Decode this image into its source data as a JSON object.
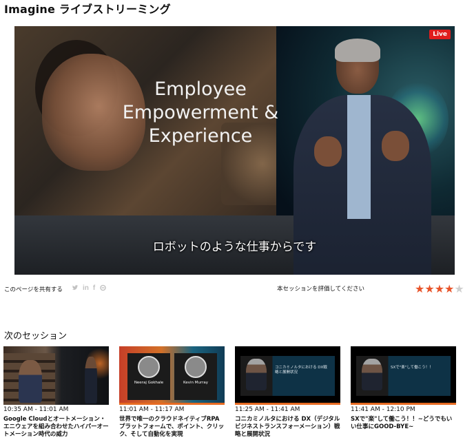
{
  "page": {
    "title": "Imagine ライブストリーミング"
  },
  "player": {
    "live_label": "Live",
    "slide_title_lines": [
      "Employee",
      "Empowerment &",
      "Experience"
    ],
    "subtitle": "ロボットのような仕事からです"
  },
  "share": {
    "label": "このページを共有する",
    "icons": [
      "twitter-icon",
      "linkedin-icon",
      "facebook-icon",
      "link-icon"
    ]
  },
  "rating": {
    "label": "本セッションを評価してください",
    "value": 4,
    "max": 5,
    "accent_color": "#e8542a"
  },
  "next_sessions": {
    "heading": "次のセッション",
    "items": [
      {
        "time": "10:35 AM - 11:01 AM",
        "title": "Google Cloudとオートメーション・エニウェアを組み合わせたハイパーオートメーション時代の威力"
      },
      {
        "time": "11:01 AM - 11:17 AM",
        "title": "世界で唯一のクラウドネイティブRPAプラットフォームで、ポイント、クリック、そして自動化を実現",
        "thumb_names": [
          "Neeraj Gokhale",
          "Kevin Murray"
        ]
      },
      {
        "time": "11:25 AM - 11:41 AM",
        "title": "コニカミノルタにおける DX（デジタルビジネストランスフォーメーション）戦略と展開状況",
        "thumb_text": "コニカミノルタにおける DX戦略と展開状況"
      },
      {
        "time": "11:41 AM - 12:10 PM",
        "title": "SXで\"楽\"して働こう！！~どうでもいい仕事にGOOD-BYE~",
        "thumb_text": "SXで\"楽\"して働こう！！"
      }
    ]
  }
}
